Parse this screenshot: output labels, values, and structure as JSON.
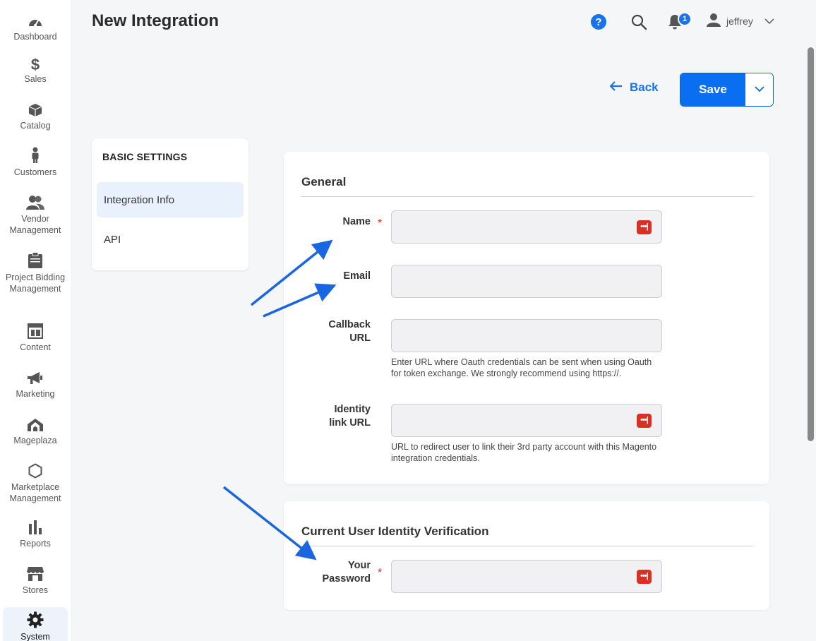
{
  "sidebar": {
    "items": [
      {
        "label": "Dashboard",
        "icon": "dashboard-icon"
      },
      {
        "label": "Sales",
        "icon": "dollar-icon"
      },
      {
        "label": "Catalog",
        "icon": "box-icon"
      },
      {
        "label": "Customers",
        "icon": "person-icon"
      },
      {
        "label": "Vendor Management",
        "icon": "users-icon"
      },
      {
        "label": "Project Bidding Management",
        "icon": "clipboard-icon"
      },
      {
        "label": "Content",
        "icon": "layout-icon"
      },
      {
        "label": "Marketing",
        "icon": "megaphone-icon"
      },
      {
        "label": "Mageplaza",
        "icon": "mageplaza-icon"
      },
      {
        "label": "Marketplace Management",
        "icon": "hexagon-icon"
      },
      {
        "label": "Reports",
        "icon": "bar-chart-icon"
      },
      {
        "label": "Stores",
        "icon": "store-icon"
      },
      {
        "label": "System",
        "icon": "gear-icon"
      }
    ],
    "active": "System"
  },
  "header": {
    "title": "New Integration",
    "help_label": "?",
    "notifications_count": "1",
    "username": "jeffrey"
  },
  "actions": {
    "back_label": "Back",
    "save_label": "Save"
  },
  "settings_nav": {
    "title": "BASIC SETTINGS",
    "links": [
      "Integration Info",
      "API"
    ],
    "active": "Integration Info"
  },
  "general": {
    "title": "General",
    "name_label": "Name",
    "email_label": "Email",
    "callback_label": "Callback URL",
    "callback_note": "Enter URL where Oauth credentials can be sent when using Oauth for token exchange. We strongly recommend using https://.",
    "identity_label": "Identity link URL",
    "identity_note": "URL to redirect user to link their 3rd party account with this Magento integration credentials."
  },
  "verification": {
    "title": "Current User Identity Verification",
    "password_label": "Your Password"
  },
  "required_mark": "*",
  "password_manager_icon": "•••|",
  "colors": {
    "accent": "#0a6ef0",
    "required": "#e02b27",
    "password_icon": "#d93025",
    "annotation_arrow": "#1a66e0"
  }
}
